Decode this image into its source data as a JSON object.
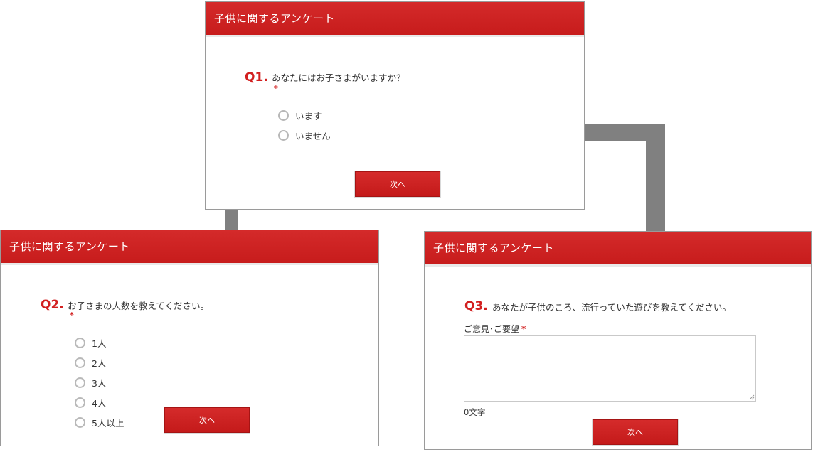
{
  "survey": {
    "title": "子供に関するアンケート",
    "next_label": "次へ",
    "required_mark": "*"
  },
  "q1": {
    "number": "Q1.",
    "text": "あなたにはお子さまがいますか？",
    "options": [
      {
        "label": "います",
        "selected": false
      },
      {
        "label": "いません",
        "selected": false
      }
    ]
  },
  "q2": {
    "number": "Q2.",
    "text": "お子さまの人数を教えてください。",
    "options": [
      {
        "label": "1人",
        "selected": false
      },
      {
        "label": "2人",
        "selected": false
      },
      {
        "label": "3人",
        "selected": false
      },
      {
        "label": "4人",
        "selected": false
      },
      {
        "label": "5人以上",
        "selected": false
      }
    ]
  },
  "q3": {
    "number": "Q3.",
    "text": "あなたが子供のころ、流行っていた遊びを教えてください。",
    "field_label": "ご意見･ご要望",
    "value": "",
    "char_count": "0文字"
  },
  "colors": {
    "accent": "#cc2222",
    "flow_arrow": "#808080"
  }
}
